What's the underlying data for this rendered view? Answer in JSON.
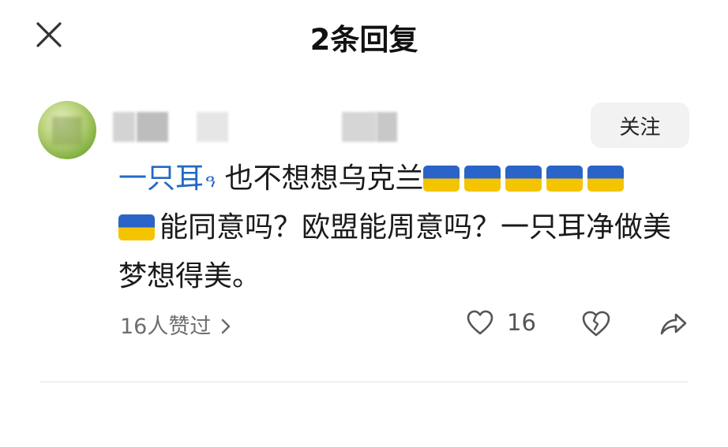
{
  "header": {
    "title": "2条回复",
    "close_icon": "close-icon"
  },
  "comment": {
    "follow_label": "关注",
    "mention": "一只耳",
    "text_part1": " 也不想想乌克兰",
    "text_part2": "能同意吗？欧盟能周意吗？一只耳净做美梦想得美。",
    "flag_emoji": "ukraine-flag",
    "flag_count_line1": 5,
    "flag_count_line2": 1,
    "likes_summary": "16人赞过",
    "like_count": "16"
  },
  "colors": {
    "mention": "#2469c3",
    "muted": "#6d6d6d",
    "button_bg": "#f2f2f2"
  }
}
